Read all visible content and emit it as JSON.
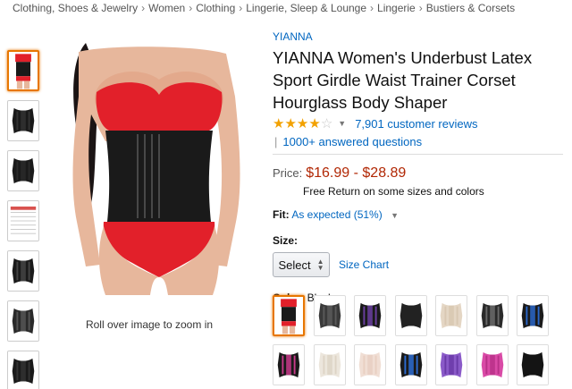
{
  "breadcrumb": [
    "Clothing, Shoes & Jewelry",
    "Women",
    "Clothing",
    "Lingerie, Sleep & Lounge",
    "Lingerie",
    "Bustiers & Corsets"
  ],
  "breadcrumb_separator": "›",
  "product": {
    "brand": "YIANNA",
    "title": "YIANNA Women's Underbust Latex Sport Girdle Waist Trainer Corset Hourglass Body Shaper",
    "rating": 4,
    "reviews": "7,901 customer reviews",
    "questions": "1000+ answered questions",
    "price_label": "Price:",
    "price": "$16.99 - $28.89",
    "returns": "Free Return on some sizes and colors",
    "fit_label": "Fit:",
    "fit_value": "As expected (51%)",
    "size_label": "Size:",
    "size_select": "Select",
    "size_chart": "Size Chart",
    "color_label": "Color:",
    "color_value": "Black"
  },
  "gallery": {
    "zoom_hint": "Roll over image to zoom in",
    "thumbnails": [
      "model-black-red",
      "corset-black-front",
      "corset-black-side",
      "size-chart",
      "corset-black-open",
      "corset-detail",
      "corset-folded"
    ]
  },
  "swatches": [
    {
      "name": "Black",
      "color": "#1a1a1a",
      "panel": "#1a1a1a",
      "model": true
    },
    {
      "name": "Black-Grey",
      "color": "#3a3a3a",
      "panel": "#5a5a5a"
    },
    {
      "name": "Black-Purple",
      "color": "#1a1a1a",
      "panel": "#6a3fa0"
    },
    {
      "name": "Black Short",
      "color": "#222222",
      "panel": "#222222"
    },
    {
      "name": "Beige",
      "color": "#e4d6c4",
      "panel": "#d8c8b2"
    },
    {
      "name": "Black-Grey 2",
      "color": "#2a2a2a",
      "panel": "#6a6a6a"
    },
    {
      "name": "Black-Blue",
      "color": "#1a1a1a",
      "panel": "#2a66c8"
    },
    {
      "name": "Black-Rose",
      "color": "#1a1a1a",
      "panel": "#c83a8a"
    },
    {
      "name": "Nude",
      "color": "#ece6dc",
      "panel": "#ddd4c6"
    },
    {
      "name": "Light Nude",
      "color": "#f0ded4",
      "panel": "#e8cfc2"
    },
    {
      "name": "Blue",
      "color": "#1a1a1a",
      "panel": "#2d6cd1"
    },
    {
      "name": "Purple",
      "color": "#8a5ac8",
      "panel": "#6a3aa8"
    },
    {
      "name": "Pink",
      "color": "#d94aa6",
      "panel": "#b83088"
    },
    {
      "name": "Black 2",
      "color": "#141414",
      "panel": "#141414"
    }
  ],
  "colors": {
    "link": "#0066c0",
    "price": "#b12704",
    "selected_border": "#e77600",
    "star": "#f2a100"
  }
}
